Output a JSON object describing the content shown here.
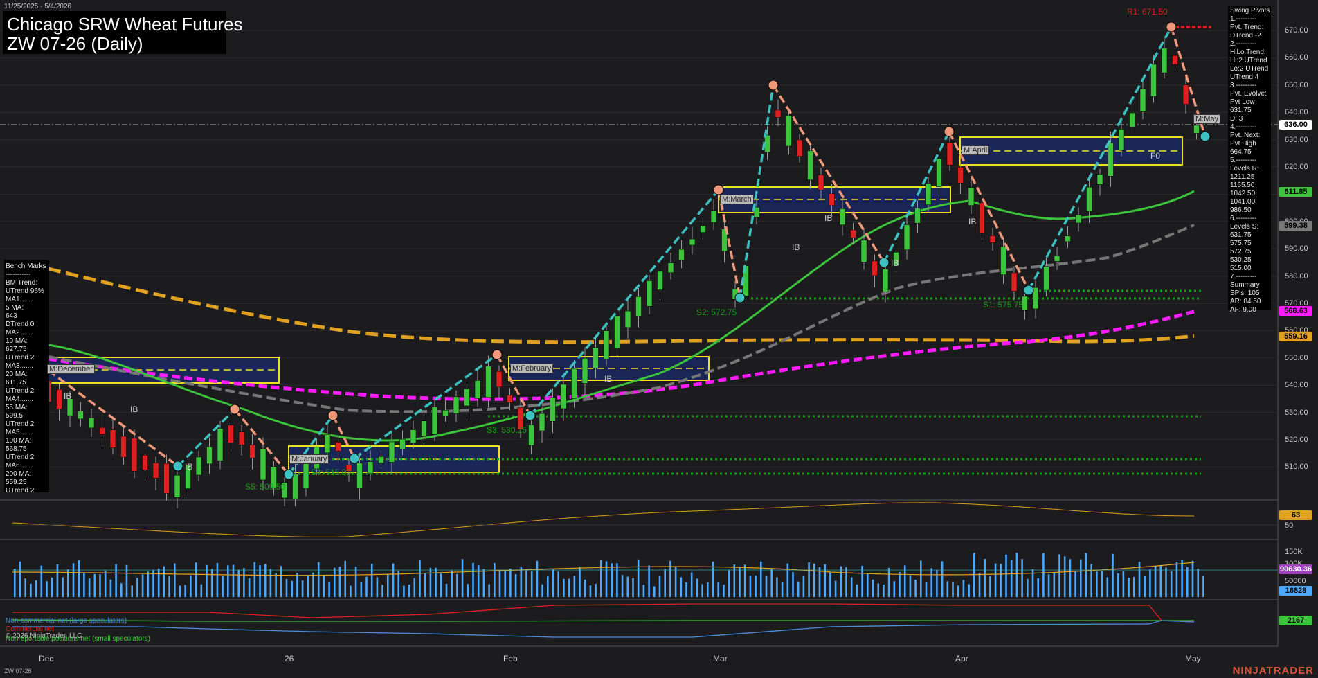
{
  "header": {
    "date_range": "11/25/2025 - 5/4/2026",
    "title_line1": "Chicago SRW Wheat Futures",
    "title_line2": "ZW 07-26 (Daily)"
  },
  "bench_marks": [
    "Bench Marks",
    "-----------",
    "BM Trend:",
    "UTrend 96%",
    "MA1.......",
    "5 MA:",
    "643",
    "DTrend 0",
    "MA2.......",
    "10 MA:",
    "627.75",
    "UTrend 2",
    "MA3.......",
    "20 MA:",
    "611.75",
    "UTrend 2",
    "MA4.......",
    "55 MA:",
    "599.5",
    "UTrend 2",
    "MA5.......",
    "100 MA:",
    "568.75",
    "UTrend 2",
    "MA6.......",
    "200 MA:",
    "559.25",
    "UTrend 2"
  ],
  "swing_pivots": [
    "Swing Pivots",
    "1.---------",
    "Pvt. Trend:",
    "DTrend -2",
    "2.---------",
    "HiLo Trend:",
    "Hi:2 UTrend",
    "Lo:2 UTrend",
    "UTrend 4",
    "3.---------",
    "Pvt. Evolve:",
    "Pvt Low",
    "631.75",
    "D: 3",
    "4.---------",
    "Pvt. Next:",
    "Pvt High",
    "664.75",
    "5.---------",
    "Levels R:",
    "1211.25",
    "1165.50",
    "1042.50",
    "1041.00",
    "986.50",
    "6.---------",
    "Levels S:",
    "631.75",
    "575.75",
    "572.75",
    "530.25",
    "515.00",
    "7.---------",
    "Summary",
    "SP's: 105",
    "AR: 84.50",
    "AF: 9.00"
  ],
  "price_axis": [
    "670.00",
    "660.00",
    "650.00",
    "640.00",
    "630.00",
    "620.00",
    "610.00",
    "600.00",
    "590.00",
    "580.00",
    "570.00",
    "560.00",
    "550.00",
    "540.00",
    "530.00",
    "520.00",
    "510.00"
  ],
  "time_axis": [
    "Dec",
    "26",
    "Feb",
    "Mar",
    "Apr",
    "May"
  ],
  "price_tags": [
    {
      "text": "636.00",
      "bg": "#ffffff"
    },
    {
      "text": "611.85",
      "bg": "#3cc43c"
    },
    {
      "text": "599.38",
      "bg": "#7a7a7a"
    },
    {
      "text": "568.63",
      "bg": "#ff1aff"
    },
    {
      "text": "559.16",
      "bg": "#e0a020"
    }
  ],
  "pivot_labels": {
    "r1": "R1: 671.50",
    "s2": "S2: 572.75",
    "s1": "S1: 575.75",
    "s3": "S3: 530.25",
    "s5": "S5: 509.50",
    "s4": "S4: 515.00"
  },
  "month_labels": [
    "M:December",
    "M:January",
    "M:February",
    "M:March",
    "M:April",
    "M:May"
  ],
  "ib_label": "IB",
  "f0_label": "F0",
  "osc": {
    "value": "63",
    "level": "50"
  },
  "volume": {
    "v1": "90630.36",
    "v2": "16828",
    "t150": "150K",
    "t100": "100K",
    "t50": "50000"
  },
  "cot": {
    "value": "2167",
    "legend": [
      {
        "text": "Non-commercial net (large speculators)",
        "color": "#4a90e2"
      },
      {
        "text": "Commercial net",
        "color": "#e02020"
      },
      {
        "text": "Nonreportable positions net (small speculators)",
        "color": "#3cc43c"
      }
    ],
    "copyright": "© 2026 NinjaTrader, LLC"
  },
  "footer": {
    "symbol": "ZW 07-26",
    "brand": "NINJATRADER"
  },
  "colors": {
    "up": "#3cc43c",
    "down": "#e02020",
    "bg": "#1c1c1e",
    "accent": "#e0533a"
  }
}
